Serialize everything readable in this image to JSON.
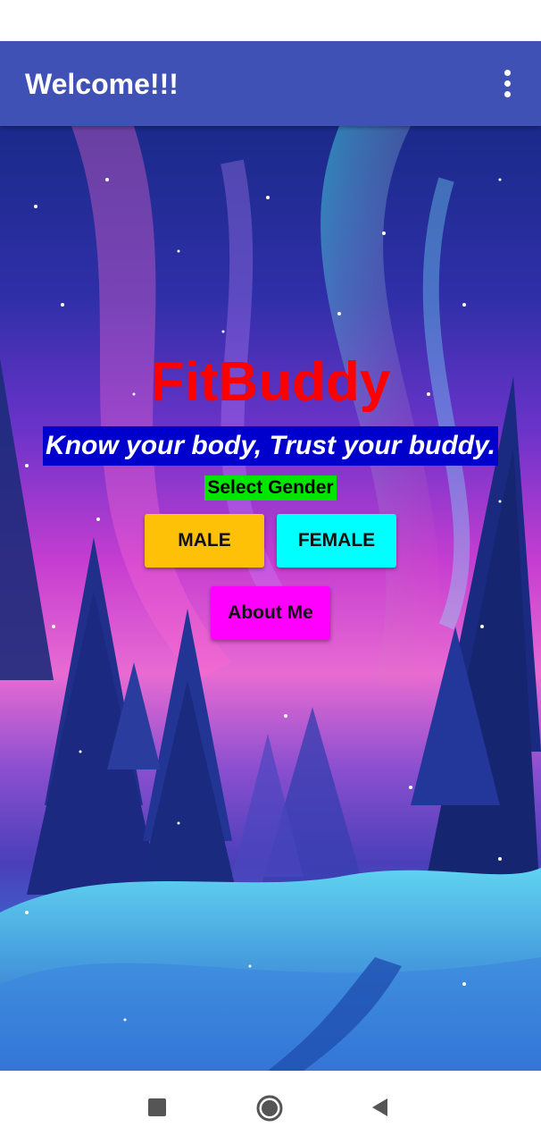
{
  "app_bar": {
    "title": "Welcome!!!",
    "background": "#3f51b5",
    "menu_icon": "overflow-menu-icon"
  },
  "main": {
    "title": "FitBuddy",
    "title_color": "#ff0000",
    "tagline": "Know your body, Trust your buddy.",
    "tagline_bg": "#0000cc",
    "select_label": "Select Gender",
    "select_label_bg": "#00e600",
    "buttons": {
      "male": {
        "label": "MALE",
        "color": "#ffc107"
      },
      "female": {
        "label": "FEMALE",
        "color": "#00ffff"
      },
      "about": {
        "label": "About Me",
        "color": "#ff00ff"
      }
    }
  },
  "nav_bar": {
    "icons": [
      "recents-icon",
      "home-icon",
      "back-icon"
    ]
  }
}
